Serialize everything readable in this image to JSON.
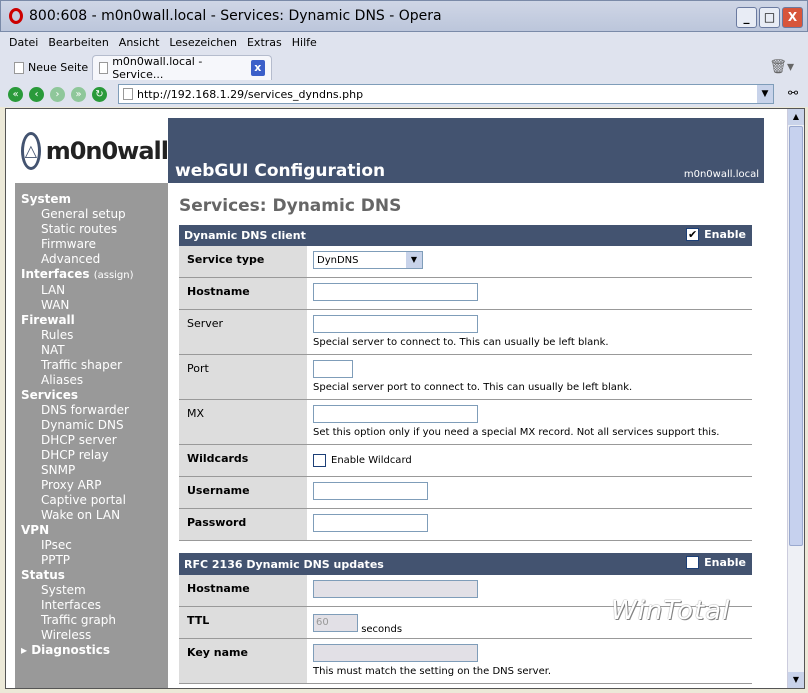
{
  "window": {
    "title": "800:608 - m0n0wall.local - Services: Dynamic DNS - Opera"
  },
  "menu": [
    "Datei",
    "Bearbeiten",
    "Ansicht",
    "Lesezeichen",
    "Extras",
    "Hilfe"
  ],
  "tabs": [
    {
      "label": "Neue Seite"
    },
    {
      "label": "m0n0wall.local - Service..."
    }
  ],
  "address": "http://192.168.1.29/services_dyndns.php",
  "logo": "m0n0wall",
  "header": {
    "title": "webGUI Configuration",
    "host": "m0n0wall.local"
  },
  "sidebar": [
    {
      "g": "System",
      "items": [
        "General setup",
        "Static routes",
        "Firmware",
        "Advanced"
      ]
    },
    {
      "g": "Interfaces",
      "extra": "(assign)",
      "items": [
        "LAN",
        "WAN"
      ]
    },
    {
      "g": "Firewall",
      "items": [
        "Rules",
        "NAT",
        "Traffic shaper",
        "Aliases"
      ]
    },
    {
      "g": "Services",
      "items": [
        "DNS forwarder",
        "Dynamic DNS",
        "DHCP server",
        "DHCP relay",
        "SNMP",
        "Proxy ARP",
        "Captive portal",
        "Wake on LAN"
      ]
    },
    {
      "g": "VPN",
      "items": [
        "IPsec",
        "PPTP"
      ]
    },
    {
      "g": "Status",
      "items": [
        "System",
        "Interfaces",
        "Traffic graph",
        "Wireless"
      ]
    },
    {
      "g": "▸ Diagnostics",
      "items": []
    }
  ],
  "page_title": "Services: Dynamic DNS",
  "dyndns": {
    "header": "Dynamic DNS client",
    "enable_label": "Enable",
    "enabled": true,
    "service_type_label": "Service type",
    "service_type": "DynDNS",
    "hostname_label": "Hostname",
    "server_label": "Server",
    "server_hint": "Special server to connect to. This can usually be left blank.",
    "port_label": "Port",
    "port_hint": "Special server port to connect to. This can usually be left blank.",
    "mx_label": "MX",
    "mx_hint": "Set this option only if you need a special MX record. Not all services support this.",
    "wildcards_label": "Wildcards",
    "wildcard_cb": "Enable Wildcard",
    "username_label": "Username",
    "password_label": "Password"
  },
  "rfc": {
    "header": "RFC 2136 Dynamic DNS updates",
    "enable_label": "Enable",
    "enabled": false,
    "hostname_label": "Hostname",
    "ttl_label": "TTL",
    "ttl_value": "60",
    "ttl_unit": "seconds",
    "keyname_label": "Key name",
    "keyname_hint": "This must match the setting on the DNS server."
  },
  "watermark": "WinTotal"
}
